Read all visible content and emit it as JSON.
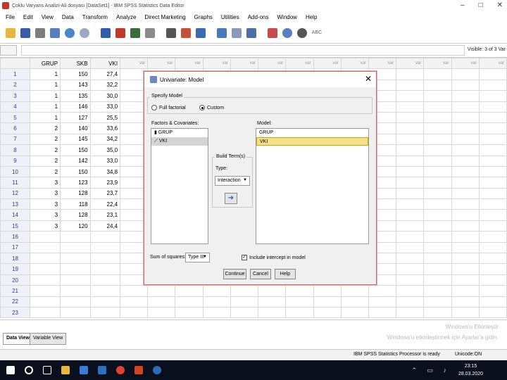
{
  "window": {
    "title": "Çoklu Varyans Analizi-Ali dosyası [DataSet1] - IBM SPSS Statistics Data Editor",
    "controls": [
      "–",
      "□",
      "✕"
    ]
  },
  "menu": [
    "File",
    "Edit",
    "View",
    "Data",
    "Transform",
    "Analyze",
    "Direct Marketing",
    "Graphs",
    "Utilities",
    "Add-ons",
    "Window",
    "Help"
  ],
  "toolbar": {
    "abc_label": "ABC"
  },
  "editbar": {
    "visible_text": "Visible: 3 of 3 Var"
  },
  "grid": {
    "columns": [
      "GRUP",
      "SKB",
      "VKI",
      "var",
      "var",
      "var",
      "var",
      "var",
      "var",
      "var",
      "var",
      "var",
      "var",
      "var",
      "var",
      "var",
      "var"
    ],
    "rows": [
      [
        "1",
        "1",
        "150",
        "27,4"
      ],
      [
        "2",
        "1",
        "143",
        "32,2"
      ],
      [
        "3",
        "1",
        "135",
        "30,0"
      ],
      [
        "4",
        "1",
        "146",
        "33,0"
      ],
      [
        "5",
        "1",
        "127",
        "25,5"
      ],
      [
        "6",
        "2",
        "140",
        "33,6"
      ],
      [
        "7",
        "2",
        "145",
        "34,2"
      ],
      [
        "8",
        "2",
        "150",
        "35,0"
      ],
      [
        "9",
        "2",
        "142",
        "33,0"
      ],
      [
        "10",
        "2",
        "150",
        "34,8"
      ],
      [
        "11",
        "3",
        "123",
        "23,9"
      ],
      [
        "12",
        "3",
        "128",
        "23,7"
      ],
      [
        "13",
        "3",
        "118",
        "22,4"
      ],
      [
        "14",
        "3",
        "128",
        "23,1"
      ],
      [
        "15",
        "3",
        "120",
        "24,4"
      ],
      [
        "16",
        "",
        "",
        ""
      ],
      [
        "17",
        "",
        "",
        ""
      ],
      [
        "18",
        "",
        "",
        ""
      ],
      [
        "19",
        "",
        "",
        ""
      ],
      [
        "20",
        "",
        "",
        ""
      ],
      [
        "21",
        "",
        "",
        ""
      ],
      [
        "22",
        "",
        "",
        ""
      ],
      [
        "23",
        "",
        "",
        ""
      ]
    ]
  },
  "tabs": {
    "data_view": "Data View",
    "variable_view": "Variable View",
    "watermark_line1": "Windows'u Etkinleştir",
    "watermark_line2": "Windows'u etkinleştirmek için Ayarlar'a gidin."
  },
  "status": {
    "processor": "IBM SPSS Statistics Processor is ready",
    "unicode": "Unicode:ON"
  },
  "taskbar": {
    "time": "23:15",
    "date": "28.03.2020"
  },
  "dialog": {
    "title": "Univariate: Model",
    "close": "✕",
    "specify_model_label": "Specify Model",
    "full_factorial": "Full factorial",
    "custom": "Custom",
    "factors_label": "Factors & Covariates:",
    "factors": [
      "GRUP",
      "VKI"
    ],
    "model_label": "Model:",
    "model_items": [
      "GRUP",
      "VKI"
    ],
    "build_terms_label": "Build Term(s)",
    "type_label": "Type:",
    "type_value": "Interaction",
    "sum_of_squares_label": "Sum of squares:",
    "sum_of_squares_value": "Type III",
    "include_intercept": "Include intercept in model",
    "buttons": {
      "continue": "Continue",
      "cancel": "Cancel",
      "help": "Help"
    }
  }
}
